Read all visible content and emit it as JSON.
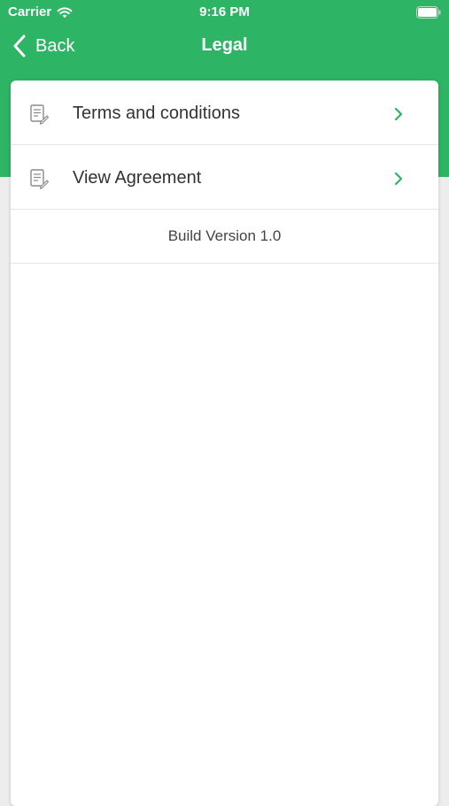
{
  "colors": {
    "header": "#2db464",
    "accent_chevron": "#2db464",
    "text": "#333333"
  },
  "status_bar": {
    "carrier": "Carrier",
    "time": "9:16 PM",
    "wifi_icon": "wifi-icon",
    "battery_icon": "battery-icon"
  },
  "nav": {
    "back_label": "Back",
    "title": "Legal"
  },
  "list": {
    "items": [
      {
        "label": "Terms and conditions",
        "icon": "document-edit-icon"
      },
      {
        "label": "View Agreement",
        "icon": "document-edit-icon"
      }
    ],
    "version": "Build Version 1.0"
  }
}
